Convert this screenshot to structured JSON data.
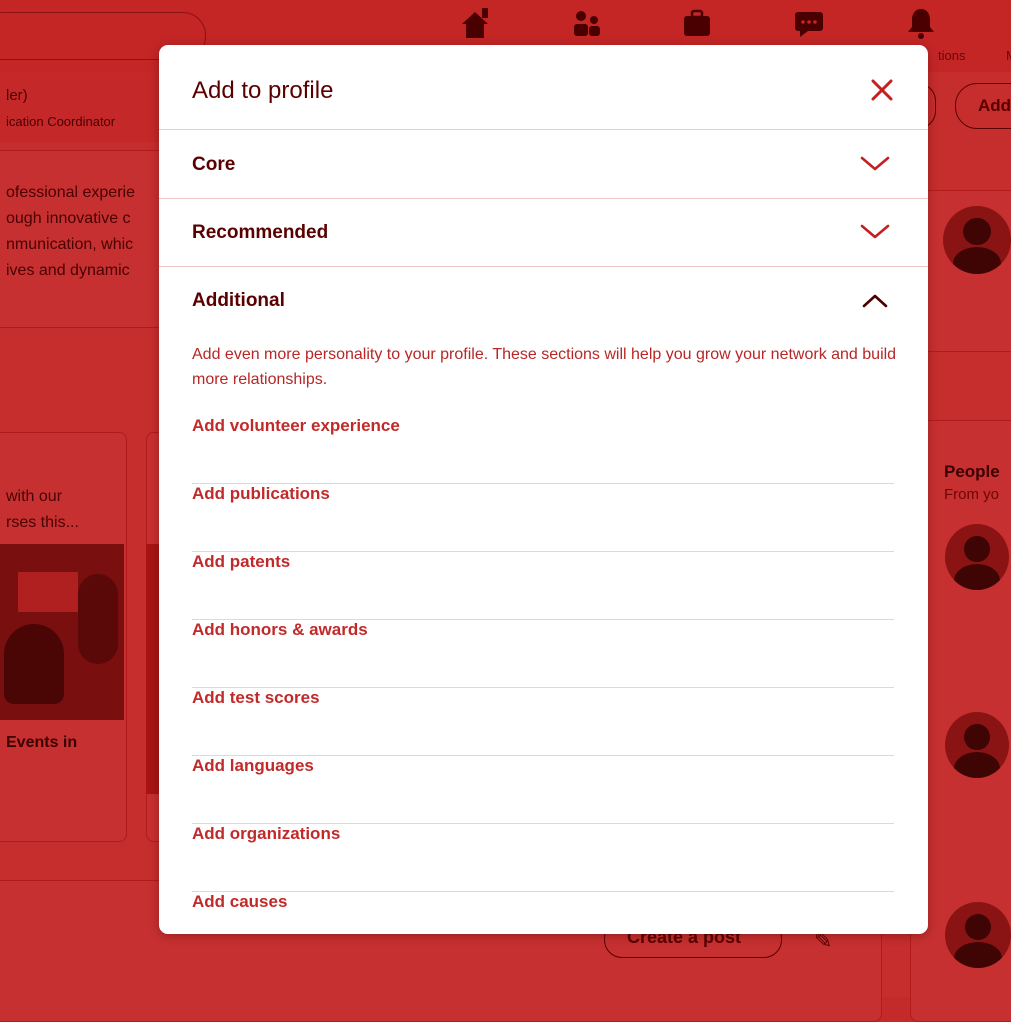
{
  "background": {
    "nav": {
      "notifications_label": "tions",
      "me_label": "M"
    },
    "profile": {
      "name_fragment": "ler)",
      "title_fragment": "ication Coordinator"
    },
    "about_lines": [
      "ofessional experie",
      "ough innovative c",
      "nmunication, whic",
      "ives and dynamic"
    ],
    "action_buttons": [
      "Add"
    ],
    "course_lines": [
      "with our",
      "rses this..."
    ],
    "events_label": "Events in",
    "people": {
      "title": "People",
      "subtitle": "From yo"
    },
    "create_post_label": "Create a post"
  },
  "modal": {
    "title": "Add to profile",
    "sections": [
      {
        "label": "Core",
        "expanded": false
      },
      {
        "label": "Recommended",
        "expanded": false
      },
      {
        "label": "Additional",
        "expanded": true
      }
    ],
    "additional_description": "Add even more personality to your profile. These sections will help you grow your network and build more relationships.",
    "additional_items": [
      "Add volunteer experience",
      "Add publications",
      "Add patents",
      "Add honors & awards",
      "Add test scores",
      "Add languages",
      "Add organizations",
      "Add causes"
    ]
  },
  "colors": {
    "overlay": "#c42a2a",
    "modal_bg": "#ffffff",
    "heading": "#5a0000",
    "link": "#c22a2a",
    "divider": "#f0c8c8"
  },
  "icons": {
    "close": "close-icon",
    "collapsed": "chevron-down-icon",
    "expanded": "chevron-up-icon"
  }
}
